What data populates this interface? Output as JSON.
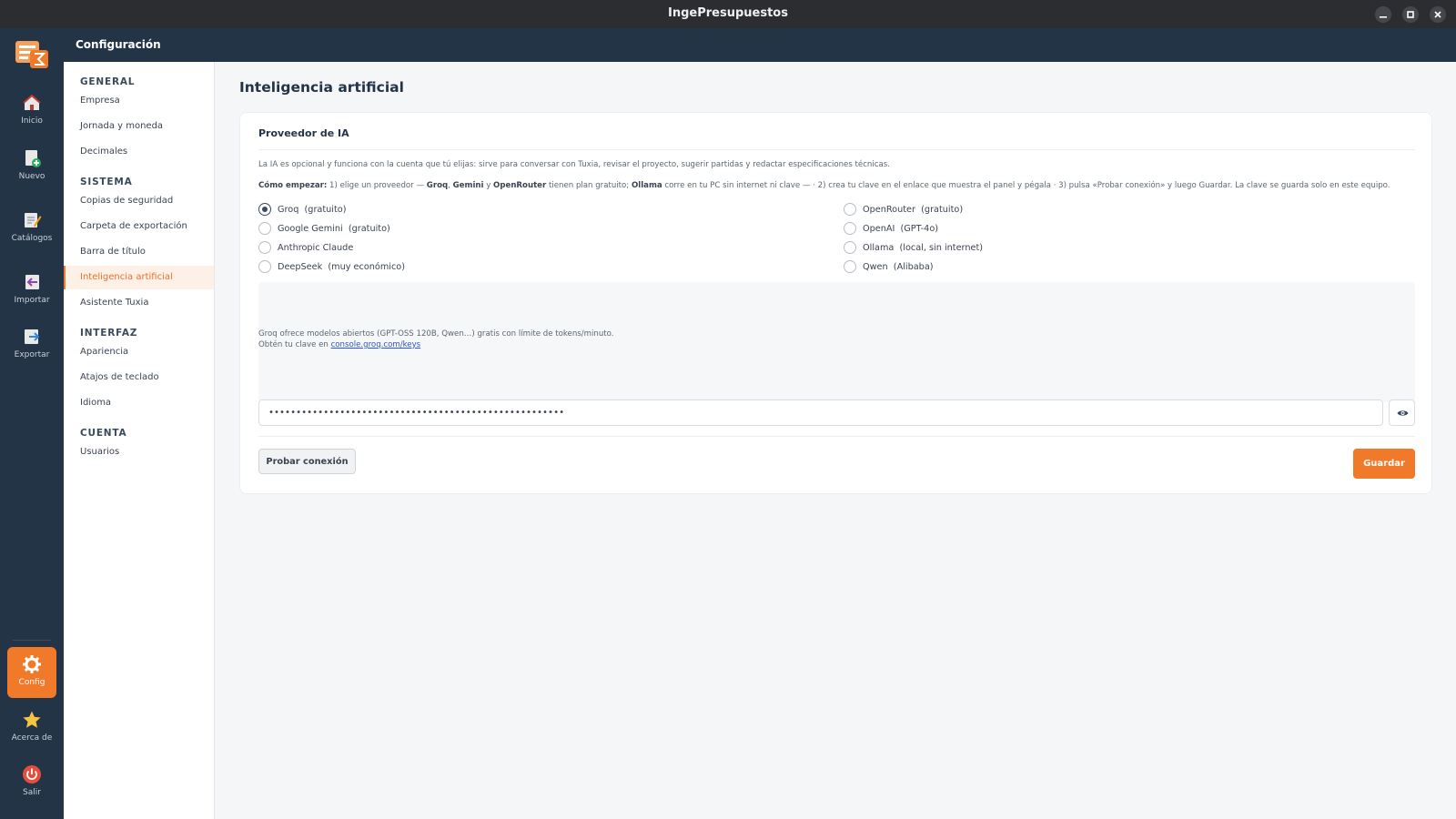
{
  "window": {
    "title": "IngePresupuestos",
    "minimize_icon": "minimize-icon",
    "maximize_icon": "maximize-icon",
    "close_icon": "close-icon"
  },
  "header": {
    "title": "Configuración"
  },
  "rail": {
    "items": [
      {
        "label": "Inicio",
        "icon": "home-icon"
      },
      {
        "label": "Nuevo",
        "icon": "new-document-icon"
      },
      {
        "label": "Catálogos",
        "icon": "catalog-icon"
      },
      {
        "label": "Importar",
        "icon": "import-icon"
      },
      {
        "label": "Exportar",
        "icon": "export-icon"
      },
      {
        "label": "Config",
        "icon": "gear-icon",
        "active": true
      },
      {
        "label": "Acerca de",
        "icon": "star-icon"
      },
      {
        "label": "Salir",
        "icon": "power-icon"
      }
    ]
  },
  "sidebar": {
    "sections": [
      {
        "title": "GENERAL",
        "items": [
          "Empresa",
          "Jornada y moneda",
          "Decimales"
        ]
      },
      {
        "title": "SISTEMA",
        "items": [
          "Copias de seguridad",
          "Carpeta de exportación",
          "Barra de título",
          "Inteligencia artificial",
          "Asistente Tuxia"
        ]
      },
      {
        "title": "INTERFAZ",
        "items": [
          "Apariencia",
          "Atajos de teclado",
          "Idioma"
        ]
      },
      {
        "title": "CUENTA",
        "items": [
          "Usuarios"
        ]
      }
    ],
    "active_item": "Inteligencia artificial"
  },
  "main": {
    "page_title": "Inteligencia artificial",
    "card_title": "Proveedor de IA",
    "description": "La IA es opcional y funciona con la cuenta que tú elijas: sirve para conversar con Tuxia, revisar el proyecto, sugerir partidas y redactar especificaciones técnicas.",
    "howto": {
      "label": "Cómo empezar:",
      "t1": " 1) elige un proveedor — ",
      "b1": "Groq",
      "t2": ", ",
      "b2": "Gemini",
      "t3": " y ",
      "b3": "OpenRouter",
      "t4": " tienen plan gratuito; ",
      "b4": "Ollama",
      "t5": " corre en tu PC sin internet ni clave — · 2) crea tu clave en el enlace que muestra el panel y pégala · 3) pulsa «Probar conexión» y luego Guardar. La clave se guarda solo en este equipo."
    },
    "providers_left": [
      {
        "label": "Groq  (gratuito)",
        "checked": true
      },
      {
        "label": "Google Gemini  (gratuito)",
        "checked": false
      },
      {
        "label": "Anthropic Claude",
        "checked": false
      },
      {
        "label": "DeepSeek  (muy económico)",
        "checked": false
      }
    ],
    "providers_right": [
      {
        "label": "OpenRouter  (gratuito)",
        "checked": false
      },
      {
        "label": "OpenAI  (GPT-4o)",
        "checked": false
      },
      {
        "label": "Ollama  (local, sin internet)",
        "checked": false
      },
      {
        "label": "Qwen  (Alibaba)",
        "checked": false
      }
    ],
    "info": {
      "line1": "Groq ofrece modelos abiertos (GPT-OSS 120B, Qwen…) gratis con límite de tokens/minuto.",
      "line2_prefix": "Obtén tu clave en ",
      "link": "console.groq.com/keys"
    },
    "api_key_masked": "••••••••••••••••••••••••••••••••••••••••••••••••••••••",
    "eye_icon": "eye-icon",
    "test_button": "Probar conexión",
    "save_button": "Guardar"
  },
  "colors": {
    "accent": "#f07a2a",
    "nav_bg": "#243447",
    "titlebar_bg": "#2b2d31",
    "link": "#2a56c6"
  }
}
